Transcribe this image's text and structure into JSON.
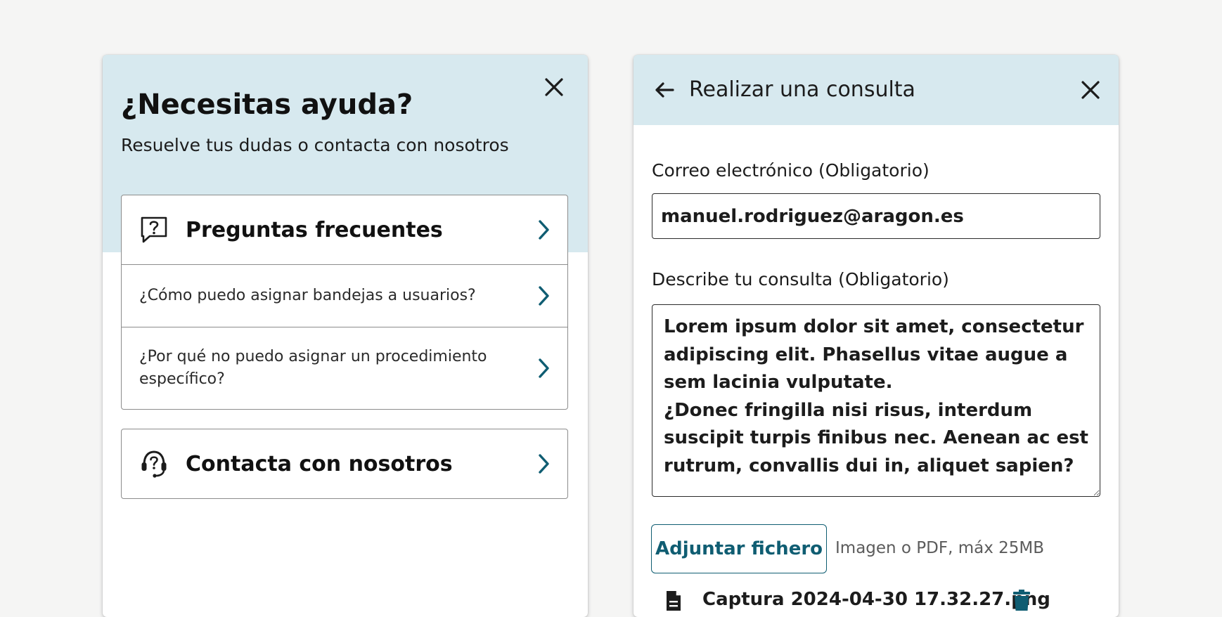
{
  "colors": {
    "background": "#f5f5f4",
    "header_bg": "#d7e9ef",
    "accent": "#0f5d72",
    "border": "#8c8c8c",
    "text": "#1c1c1c",
    "hint": "#5b5b5b"
  },
  "help_panel": {
    "title": "¿Necesitas ayuda?",
    "subtitle": "Resuelve tus dudas o contacta con nosotros",
    "close_icon": "close-icon",
    "faq": {
      "icon": "question-bubble-icon",
      "title": "Preguntas frecuentes",
      "questions": [
        "¿Cómo puedo asignar bandejas a usuarios?",
        "¿Por qué no puedo asignar un procedimiento específico?"
      ]
    },
    "contact": {
      "icon": "headset-help-icon",
      "title": "Contacta con nosotros"
    },
    "chevron_icon": "chevron-right-icon"
  },
  "query_panel": {
    "back_icon": "arrow-left-icon",
    "title": "Realizar una consulta",
    "close_icon": "close-icon",
    "email": {
      "label": "Correo electrónico (Obligatorio)",
      "value": "manuel.rodriguez@aragon.es"
    },
    "description": {
      "label": "Describe tu consulta (Obligatorio)",
      "value": "Lorem ipsum dolor sit amet, consectetur adipiscing elit. Phasellus vitae augue a sem lacinia vulputate.\n¿Donec fringilla nisi risus, interdum suscipit turpis finibus nec. Aenean ac est rutrum, convallis dui in, aliquet sapien?"
    },
    "attach": {
      "button_label": "Adjuntar fichero",
      "hint": "Imagen o PDF, máx 25MB"
    },
    "file": {
      "icon": "file-icon",
      "name": "Captura 2024-04-30 17.32.27.png",
      "delete_icon": "trash-icon"
    }
  }
}
